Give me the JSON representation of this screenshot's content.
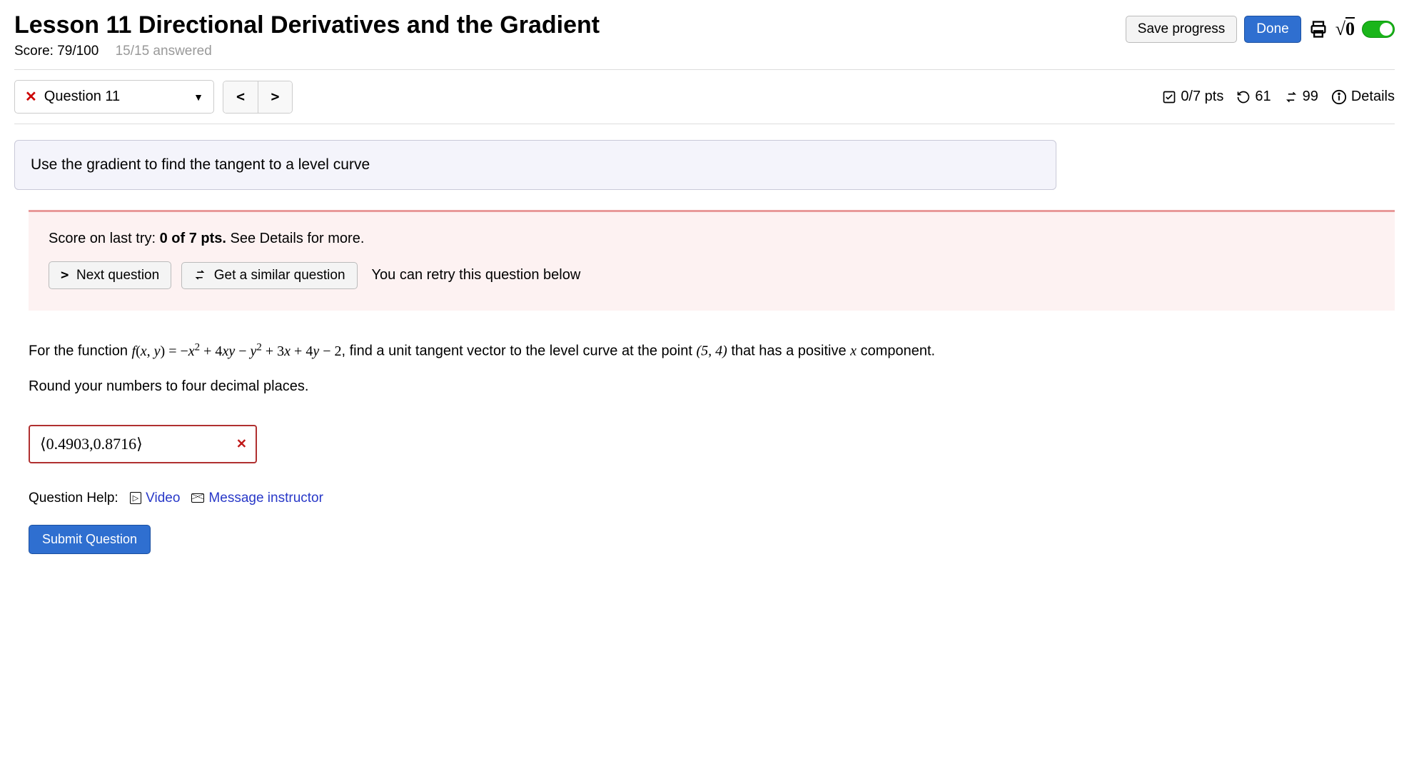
{
  "header": {
    "title": "Lesson 11 Directional Derivatives and the Gradient",
    "score_label": "Score:",
    "score_value": "79/100",
    "answered": "15/15 answered"
  },
  "topbar": {
    "save": "Save progress",
    "done": "Done"
  },
  "qnav": {
    "current": "Question 11",
    "points": "0/7 pts",
    "retries": "61",
    "attempts": "99",
    "details": "Details"
  },
  "instruction": "Use the gradient to find the tangent to a level curve",
  "feedback": {
    "prefix": "Score on last try: ",
    "bold": "0 of 7 pts.",
    "suffix": " See Details for more.",
    "next": "Next question",
    "similar": "Get a similar question",
    "retry": "You can retry this question below"
  },
  "question": {
    "line1_pre": "For the function ",
    "func_lhs": "f(x, y) = ",
    "func_rhs": "−x² + 4xy − y² + 3x + 4y − 2",
    "line1_post": ", find a unit tangent vector to the level curve at the point ",
    "point": "(5, 4)",
    "line1_tail": " that has a positive ",
    "xvar": "x",
    "line1_end": " component.",
    "round": "Round your numbers to four decimal places."
  },
  "answer": {
    "value": "⟨0.4903,0.8716⟩"
  },
  "help": {
    "label": "Question Help:",
    "video": "Video",
    "message": "Message instructor"
  },
  "submit": "Submit Question"
}
